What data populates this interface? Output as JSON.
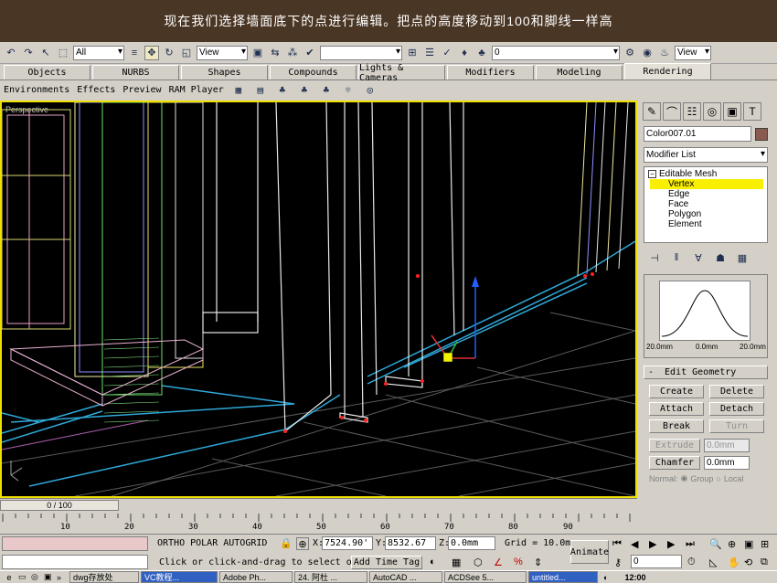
{
  "banner": {
    "text": "现在我们选择墙面底下的点进行编辑。把点的高度移动到100和脚线一样高"
  },
  "toolbar1": {
    "select_filter": "All",
    "ref_coord": "View",
    "named_sel": "",
    "layer": "0",
    "right_view": "View"
  },
  "tabs": [
    {
      "label": "Objects",
      "w": 100
    },
    {
      "label": "NURBS",
      "w": 98
    },
    {
      "label": "Shapes",
      "w": 100
    },
    {
      "label": "Compounds",
      "w": 100
    },
    {
      "label": "Lights & Cameras",
      "w": 92
    },
    {
      "label": "Modifiers",
      "w": 100
    },
    {
      "label": "Modeling",
      "w": 100
    },
    {
      "label": "Rendering",
      "w": 100
    }
  ],
  "toolbar2": {
    "items": [
      "Environments",
      "Effects",
      "Preview",
      "RAM Player"
    ]
  },
  "viewport": {
    "label": "Perspective"
  },
  "panel": {
    "object_name": "Color007.01",
    "modifier_list": "Modifier List",
    "stack_root": "Editable Mesh",
    "stack_items": [
      "Vertex",
      "Edge",
      "Face",
      "Polygon",
      "Element"
    ],
    "curve_left": "20.0mm",
    "curve_mid": "0.0mm",
    "curve_right": "20.0mm",
    "rollout_title": "Edit Geometry",
    "rollout_sign": "-",
    "btn_create": "Create",
    "btn_delete": "Delete",
    "btn_attach": "Attach",
    "btn_detach": "Detach",
    "btn_break": "Break",
    "btn_turn": "Turn",
    "btn_extrude": "Extrude",
    "extrude_val": "0.0mm",
    "btn_chamfer": "Chamfer",
    "chamfer_val": "0.0mm",
    "opt_normal": "Normal:",
    "opt_group": "Group",
    "opt_local": "Local"
  },
  "timeline": {
    "frame": "0 / 100",
    "ticks": [
      "10",
      "20",
      "30",
      "40",
      "50",
      "60",
      "70",
      "80",
      "90"
    ]
  },
  "status": {
    "snaps": "ORTHO  POLAR  AUTOGRID",
    "x_label": "X:",
    "x_val": "7524.90'",
    "y_label": "Y:",
    "y_val": "8532.67",
    "z_label": "Z:",
    "z_val": "0.0mm",
    "grid": "Grid = 10.0mm",
    "prompt": "Click or click-and-drag to select o",
    "add_time_tag": "Add Time Tag",
    "animate": "Animate",
    "frame_field": "0"
  },
  "taskbar": {
    "items": [
      "dwg存放处",
      "VC教程...",
      "Adobe Ph...",
      "24. 阿杜 ...",
      "AutoCAD ...",
      "ACDSee 5...",
      "untitled..."
    ],
    "clock": "12:00"
  }
}
